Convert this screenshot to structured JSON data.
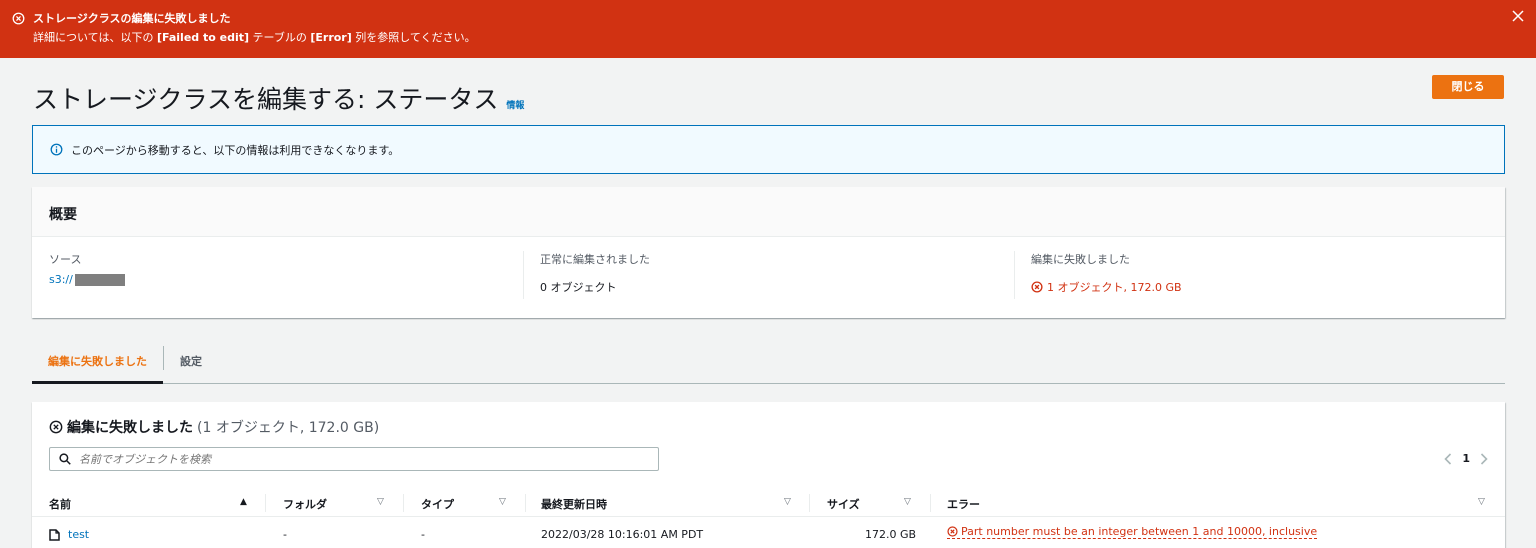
{
  "flash": {
    "title": "ストレージクラスの編集に失敗しました",
    "body_prefix": "詳細については、以下の",
    "body_tab": "[Failed to edit]",
    "body_mid": "テーブルの",
    "body_col": "[Error]",
    "body_suffix": "列を参照してください。",
    "color": "#d13212"
  },
  "page": {
    "title": "ストレージクラスを編集する: ステータス",
    "info_link": "情報",
    "close_button": "閉じる"
  },
  "alert": {
    "text": "このページから移動すると、以下の情報は利用できなくなります。"
  },
  "summary": {
    "header": "概要",
    "source_label": "ソース",
    "source_value": "s3://",
    "success_label": "正常に編集されました",
    "success_value": "0 オブジェクト",
    "failed_label": "編集に失敗しました",
    "failed_value": "1 オブジェクト, 172.0 GB"
  },
  "tabs": [
    {
      "label": "編集に失敗しました",
      "active": true
    },
    {
      "label": "設定",
      "active": false
    }
  ],
  "table": {
    "title": "編集に失敗しました",
    "count": "(1 オブジェクト, 172.0 GB)",
    "search_placeholder": "名前でオブジェクトを検索",
    "page_number": "1",
    "columns": [
      "名前",
      "フォルダ",
      "タイプ",
      "最終更新日時",
      "サイズ",
      "エラー"
    ],
    "rows": [
      {
        "name": "test",
        "folder": "-",
        "type": "-",
        "modified": "2022/03/28 10:16:01 AM PDT",
        "size": "172.0 GB",
        "error": "Part number must be an integer between 1 and 10000, inclusive"
      }
    ]
  },
  "colors": {
    "primary_button": "#ec7211",
    "link": "#0073bb",
    "error": "#d13212",
    "info_border": "#0073bb"
  }
}
